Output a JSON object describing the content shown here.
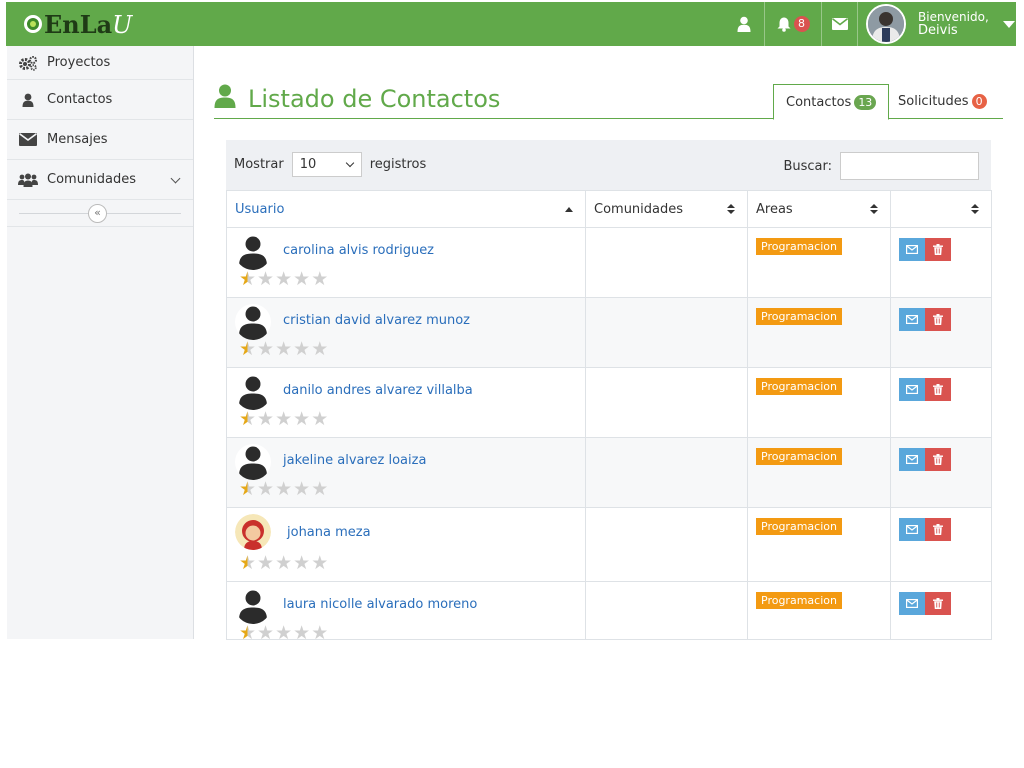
{
  "brand": {
    "logo_text": "EnLa",
    "logo_suffix": "U"
  },
  "topbar": {
    "notifications_count": "8",
    "welcome": "Bienvenido,",
    "user_name": "Deivis"
  },
  "sidebar": {
    "items": [
      {
        "label": "Proyectos",
        "icon": "gears-icon"
      },
      {
        "label": "Contactos",
        "icon": "user-icon"
      },
      {
        "label": "Mensajes",
        "icon": "envelope-icon"
      },
      {
        "label": "Comunidades",
        "icon": "users-icon"
      }
    ],
    "collapse_glyph": "«"
  },
  "page": {
    "title": "Listado de Contactos",
    "tabs": [
      {
        "label": "Contactos",
        "count": "13"
      },
      {
        "label": "Solicitudes",
        "count": "0"
      }
    ]
  },
  "controls": {
    "show_label": "Mostrar",
    "page_size": "10",
    "records_label": "registros",
    "search_label": "Buscar:",
    "search_value": ""
  },
  "table": {
    "columns": [
      "Usuario",
      "Comunidades",
      "Areas",
      ""
    ],
    "rows": [
      {
        "name": "carolina alvis rodriguez",
        "area": "Programacion",
        "rating": 0.5,
        "avatar": "default"
      },
      {
        "name": "cristian david alvarez munoz",
        "area": "Programacion",
        "rating": 0.5,
        "avatar": "default"
      },
      {
        "name": "danilo andres alvarez villalba",
        "area": "Programacion",
        "rating": 0.5,
        "avatar": "default"
      },
      {
        "name": "jakeline alvarez loaiza",
        "area": "Programacion",
        "rating": 0.5,
        "avatar": "default"
      },
      {
        "name": "johana meza",
        "area": "Programacion",
        "rating": 0.5,
        "avatar": "female"
      },
      {
        "name": "laura nicolle alvarado moreno",
        "area": "Programacion",
        "rating": 0.5,
        "avatar": "default"
      }
    ]
  },
  "colors": {
    "brand_green": "#61a94a",
    "link_blue": "#2a6ebb",
    "area_orange": "#f39a12",
    "mail_blue": "#5aa7db",
    "delete_red": "#d9534f",
    "star_gold": "#e6a817"
  }
}
